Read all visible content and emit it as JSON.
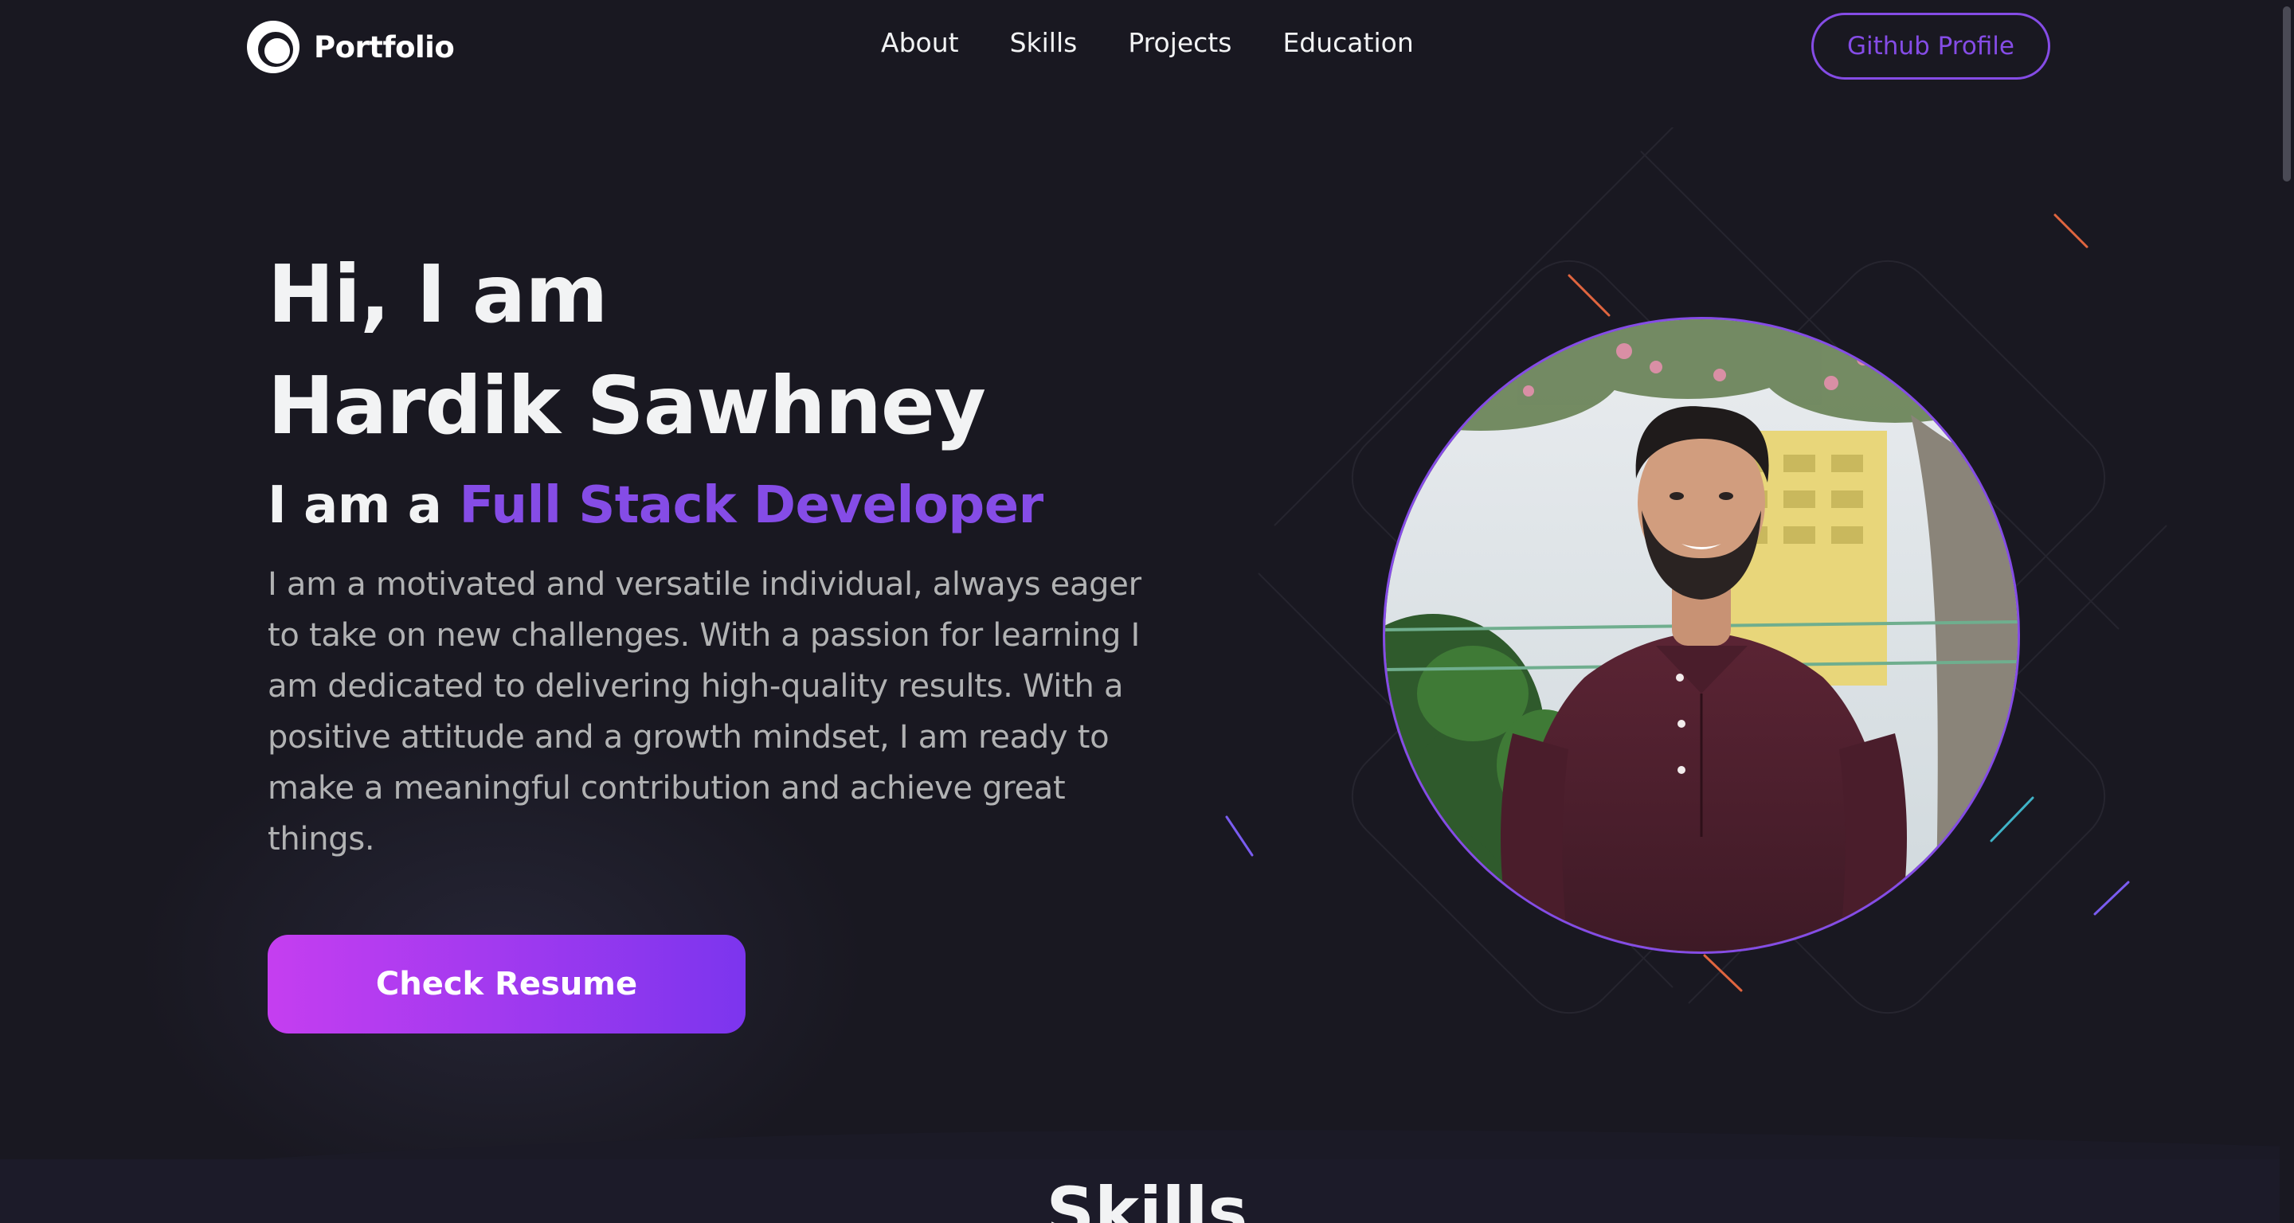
{
  "nav": {
    "logo_text": "Portfolio",
    "links": [
      "About",
      "Skills",
      "Projects",
      "Education"
    ],
    "github_label": "Github Profile"
  },
  "hero": {
    "greeting": "Hi, I am",
    "name": "Hardik Sawhney",
    "role_prefix": "I am a",
    "role": "Full Stack Developer",
    "description": "I am a motivated and versatile individual, always eager to take on new challenges. With a passion for learning I am dedicated to delivering high-quality results. With a positive attitude and a growth mindset, I am ready to make a meaningful contribution and achieve great things.",
    "resume_label": "Check Resume"
  },
  "next_section": {
    "title": "Skills"
  },
  "colors": {
    "background": "#191821",
    "primary": "#854ce6",
    "text_primary": "#f2f3f4",
    "text_secondary": "#b1b2b3",
    "button_gradient_start": "#c53ef0",
    "button_gradient_end": "#7c35ee"
  }
}
